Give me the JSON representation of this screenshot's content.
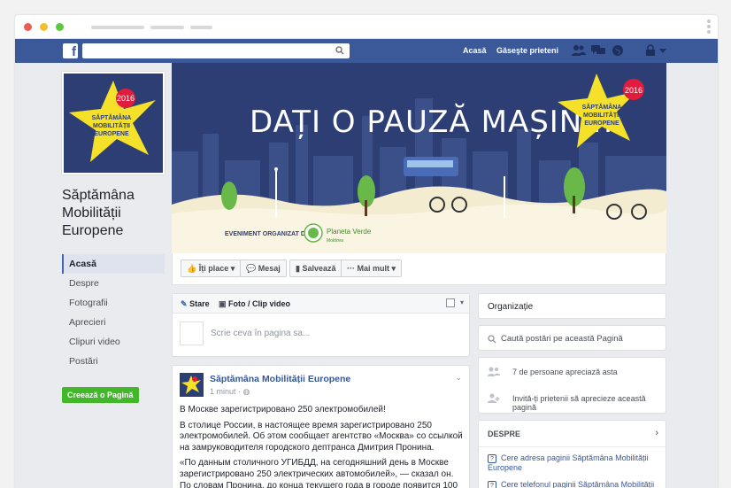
{
  "browser": {
    "dots": [
      "#ee5c54",
      "#f4bc2f",
      "#5cc93f"
    ]
  },
  "topbar": {
    "logo": "f",
    "search_placeholder": "",
    "nav": [
      "Acasă",
      "Găseşte prieteni"
    ]
  },
  "page": {
    "name": "Săptămâna Mobilității Europene",
    "logo_year": "2016",
    "logo_text": [
      "SĂPTĂMÂNA",
      "MOBILITĂȚII",
      "EUROPENE"
    ]
  },
  "sidebar": {
    "items": [
      {
        "label": "Acasă",
        "active": true
      },
      {
        "label": "Despre"
      },
      {
        "label": "Fotografii"
      },
      {
        "label": "Aprecieri"
      },
      {
        "label": "Clipuri video"
      },
      {
        "label": "Postări"
      }
    ],
    "create_button": "Creează o Pagină"
  },
  "cover": {
    "headline": "DAȚI O PAUZĂ MAȘINII!",
    "organizer_label": "EVENIMENT ORGANIZAT DE",
    "organizer_name": "Planeta Verde",
    "organizer_sub": "Moldova",
    "logo_year": "2016",
    "logo_text": [
      "SĂPTĂMÂNA",
      "MOBILITĂȚII",
      "EUROPENE"
    ]
  },
  "actions": {
    "like": "Îți place",
    "message": "Mesaj",
    "save": "Salvează",
    "more": "Mai mult"
  },
  "composer": {
    "tab_status": "Stare",
    "tab_photo": "Foto / Clip video",
    "placeholder": "Scrie ceva în pagina sa..."
  },
  "post": {
    "author": "Săptămâna Mobilității Europene",
    "time": "1 minut ·",
    "paragraphs": [
      "В Москве зарегистрировано 250 электромобилей!",
      "В столице России, в настоящее время зарегистрировано 250 электромобилей. Об этом сообщает агентство «Москва» со ссылкой на замруководителя городского дептранса Дмитрия Пронина.",
      "«По данным столичного УГИБДД, на сегодняшний день в Москве зарегистрировано 250 электрических автомобилей», — сказал он.",
      "По словам Пронина, до конца текущего года в городе появится 100"
    ]
  },
  "right": {
    "category": "Organizație",
    "search_placeholder": "Caută postări pe această Pagină",
    "likes": "7 de persoane apreciază asta",
    "invite": "Invită-ți prietenii să aprecieze această pagină",
    "about_title": "DESPRE",
    "links": [
      "Cere adresa paginii Săptămâna Mobilității Europene",
      "Cere telefonul paginii Săptămâna Mobilității"
    ]
  },
  "colors": {
    "fb_blue": "#3b5998",
    "link": "#365899",
    "green": "#42b72a",
    "cover_navy": "#2c3e73",
    "star_yellow": "#f5e12a"
  }
}
